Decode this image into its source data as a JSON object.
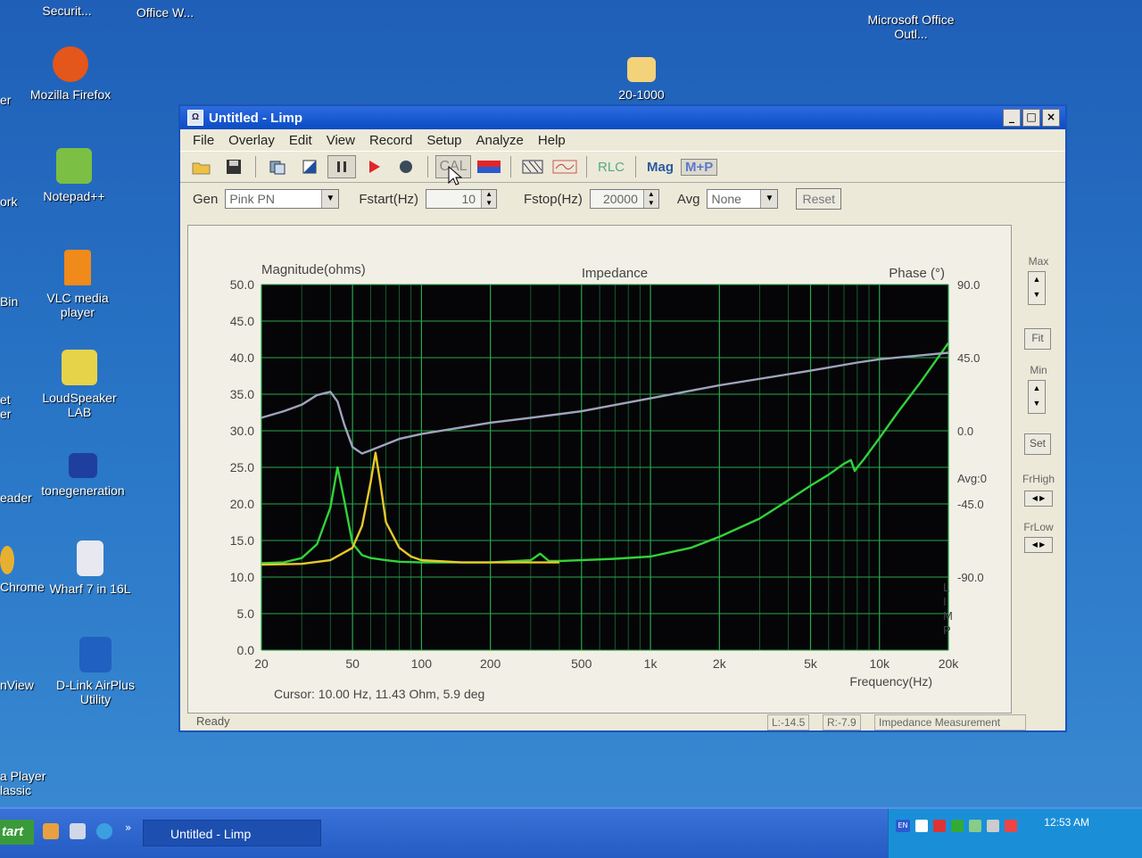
{
  "desktop": {
    "icons": [
      {
        "label": "Securit...",
        "color": "#c33"
      },
      {
        "label": "Office W...",
        "color": "#2a5caa"
      },
      {
        "label": "Microsoft Office Outl...",
        "color": "#e67e22"
      },
      {
        "label": "Mozilla Firefox",
        "color": "#e4561a"
      },
      {
        "label": "20-1000",
        "color": "#f3d27a"
      },
      {
        "label": "Notepad++",
        "color": "#7bbf44"
      },
      {
        "label": "VLC media player",
        "color": "#f08a1a"
      },
      {
        "label": "LoudSpeaker LAB",
        "color": "#2e6db4"
      },
      {
        "label": "tonegeneration",
        "color": "#1f3fa0"
      },
      {
        "label": "Wharf 7 in 16L",
        "color": "#e8e8f0"
      },
      {
        "label": "D-Link AirPlus Utility",
        "color": "#2060c0"
      },
      {
        "label": "ork",
        "color": ""
      },
      {
        "label": "Bin",
        "color": ""
      },
      {
        "label": "et er",
        "color": ""
      },
      {
        "label": "eader",
        "color": ""
      },
      {
        "label": "Chrome",
        "color": ""
      },
      {
        "label": "nView",
        "color": ""
      },
      {
        "label": "a Player lassic",
        "color": ""
      },
      {
        "label": "er",
        "color": ""
      }
    ]
  },
  "window": {
    "title": "Untitled - Limp",
    "controls": [
      "_",
      "□",
      "×"
    ]
  },
  "menu": [
    "File",
    "Overlay",
    "Edit",
    "View",
    "Record",
    "Setup",
    "Analyze",
    "Help"
  ],
  "toolbar": {
    "icons": [
      "open-icon",
      "save-icon",
      "copy-icon",
      "edit-icon",
      "pause-icon",
      "play-icon",
      "record-icon"
    ],
    "cal_label": "CAL",
    "rlc_label": "RLC",
    "mag_label": "Mag",
    "mp_label": "M+P"
  },
  "genbar": {
    "gen_label": "Gen",
    "gen_value": "Pink PN",
    "fstart_label": "Fstart(Hz)",
    "fstart_value": "10",
    "fstop_label": "Fstop(Hz)",
    "fstop_value": "20000",
    "avg_label": "Avg",
    "avg_value": "None",
    "reset_label": "Reset"
  },
  "side": {
    "max_label": "Max",
    "fit_label": "Fit",
    "min_label": "Min",
    "set_label": "Set",
    "frhigh_label": "FrHigh",
    "frlow_label": "FrLow"
  },
  "status": {
    "ready": "Ready",
    "l_value": "L:-14.5",
    "r_value": "R:-7.9",
    "mode": "Impedance Measurement"
  },
  "chart_data": {
    "type": "line",
    "title": "Impedance",
    "ylabel": "Magnitude(ohms)",
    "y2label": "Phase (°)",
    "xlabel": "Frequency(Hz)",
    "x_scale": "log",
    "xlim": [
      20,
      20000
    ],
    "ylim": [
      0,
      50
    ],
    "y2lim": [
      -135,
      90
    ],
    "x_ticks": [
      20,
      50,
      100,
      200,
      500,
      1000,
      2000,
      5000,
      10000,
      20000
    ],
    "x_tick_labels": [
      "20",
      "50",
      "100",
      "200",
      "500",
      "1k",
      "2k",
      "5k",
      "10k",
      "20k"
    ],
    "y_ticks": [
      "0.0",
      "5.0",
      "10.0",
      "15.0",
      "20.0",
      "25.0",
      "30.0",
      "35.0",
      "40.0",
      "45.0",
      "50.0"
    ],
    "y2_ticks": [
      "90.0",
      "45.0",
      "0.0",
      "-45.0",
      "-90.0"
    ],
    "avg_label": "Avg:0",
    "side_text": "LIMP",
    "cursor_readout": "Cursor: 10.00 Hz, 11.43 Ohm, 5.9 deg",
    "grid": true,
    "series": [
      {
        "color": "#32d23a",
        "x": [
          20,
          25,
          30,
          35,
          40,
          43,
          46,
          50,
          55,
          60,
          70,
          80,
          100,
          150,
          200,
          300,
          330,
          360,
          400,
          500,
          700,
          1000,
          1500,
          2000,
          3000,
          4000,
          5000,
          6000,
          7000,
          7500,
          7800,
          8000,
          8500,
          10000,
          12000,
          15000,
          20000
        ],
        "y": [
          11.9,
          12.0,
          12.6,
          14.5,
          19.5,
          25.0,
          20.5,
          14.6,
          13.0,
          12.6,
          12.3,
          12.1,
          12.0,
          12.0,
          12.0,
          12.3,
          13.2,
          12.2,
          12.2,
          12.3,
          12.5,
          12.8,
          14.0,
          15.5,
          18.0,
          20.5,
          22.5,
          24.0,
          25.5,
          26.0,
          24.5,
          25.0,
          26.0,
          29.0,
          32.5,
          36.5,
          42.0
        ]
      },
      {
        "color": "#e8c82a",
        "x": [
          20,
          30,
          40,
          50,
          55,
          60,
          63,
          66,
          70,
          80,
          90,
          100,
          150,
          200,
          300,
          400
        ],
        "y": [
          11.7,
          11.8,
          12.3,
          14.0,
          17.0,
          23.0,
          27.0,
          23.0,
          17.5,
          14.0,
          12.8,
          12.3,
          12.0,
          12.0,
          12.0,
          12.0
        ]
      },
      {
        "color": "#9fa4bb",
        "x": [
          20,
          25,
          30,
          35,
          40,
          43,
          46,
          50,
          55,
          60,
          80,
          100,
          200,
          300,
          500,
          1000,
          2000,
          5000,
          8000,
          10000,
          20000
        ],
        "y2": [
          8,
          12,
          16,
          22,
          24,
          18,
          4,
          -10,
          -14,
          -12,
          -5,
          -2,
          5,
          8,
          12,
          20,
          28,
          37,
          42,
          44,
          48
        ]
      }
    ]
  },
  "taskbar": {
    "start": "tart",
    "task": "Untitled - Limp",
    "lang": "EN",
    "clock": "12:53 AM"
  }
}
